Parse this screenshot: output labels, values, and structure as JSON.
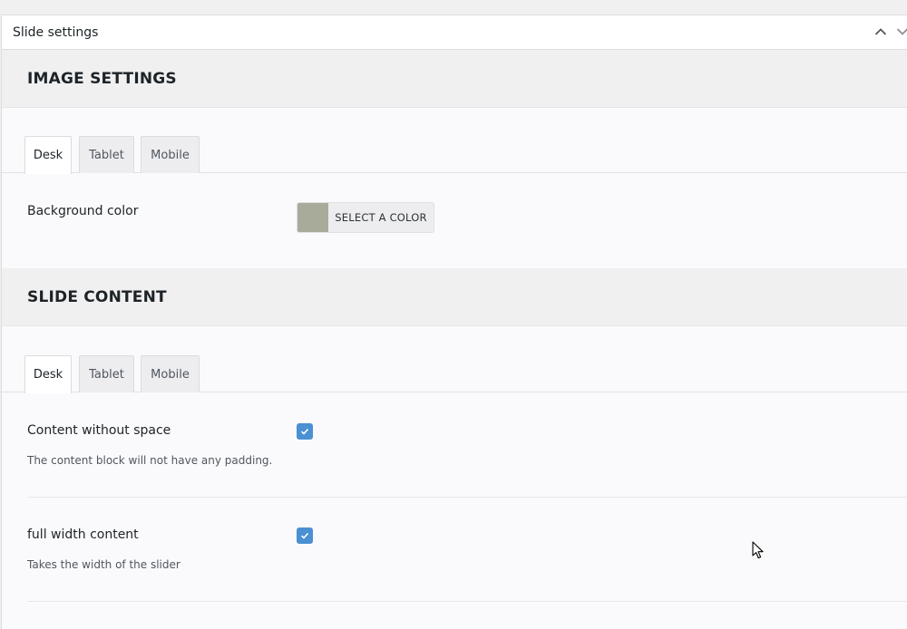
{
  "panel": {
    "title": "Slide settings"
  },
  "image_settings": {
    "title": "IMAGE SETTINGS",
    "tabs": [
      "Desk",
      "Tablet",
      "Mobile"
    ],
    "active_tab": "Desk",
    "background_color": {
      "label": "Background color",
      "button_label": "SELECT A COLOR",
      "swatch": "#a9ab9a"
    }
  },
  "slide_content": {
    "title": "SLIDE CONTENT",
    "tabs": [
      "Desk",
      "Tablet",
      "Mobile"
    ],
    "active_tab": "Desk",
    "fields": [
      {
        "label": "Content without space",
        "description": "The content block will not have any padding.",
        "checked": true
      },
      {
        "label": "full width content",
        "description": "Takes the width of the slider",
        "checked": true
      }
    ]
  },
  "colors": {
    "checkbox": "#4a90d2",
    "accent_text": "#1d2327"
  },
  "icons": {
    "collapse": "chevron-up-icon",
    "expand": "chevron-down-icon",
    "checkmark": "checkmark-icon",
    "cursor": "mouse-cursor-icon"
  }
}
